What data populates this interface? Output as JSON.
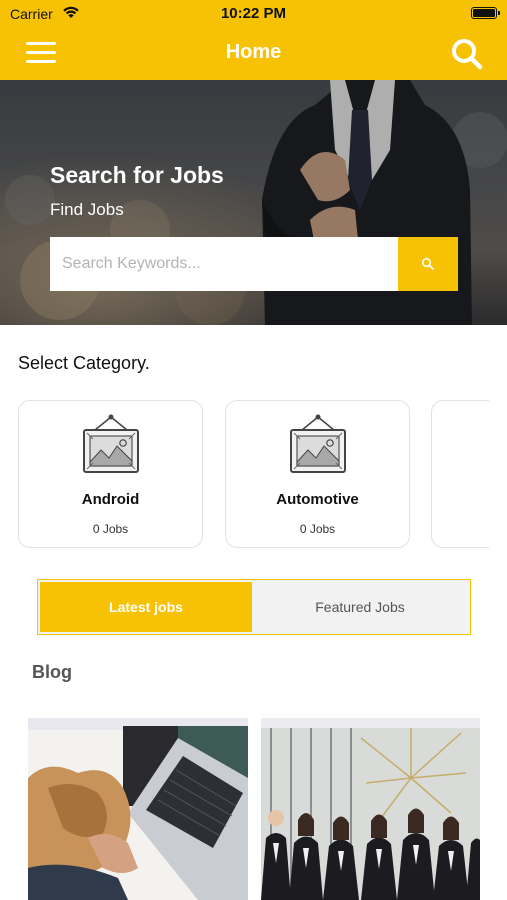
{
  "status_bar": {
    "carrier": "Carrier",
    "time": "10:22 PM"
  },
  "nav": {
    "title": "Home",
    "menu_icon": "hamburger-menu-icon",
    "search_icon": "search-icon"
  },
  "hero": {
    "title": "Search for Jobs",
    "subtitle": "Find Jobs",
    "search": {
      "placeholder": "Search Keywords...",
      "value": "",
      "button_icon": "search-icon"
    }
  },
  "categories": {
    "heading": "Select Category.",
    "items": [
      {
        "name": "Android",
        "count": "0 Jobs",
        "icon": "picture-frame-icon"
      },
      {
        "name": "Automotive",
        "count": "0 Jobs",
        "icon": "picture-frame-icon"
      }
    ]
  },
  "tabs": {
    "latest": "Latest jobs",
    "featured": "Featured Jobs",
    "selected": "latest"
  },
  "blog": {
    "heading": "Blog"
  },
  "colors": {
    "accent": "#f7c204",
    "white": "#ffffff",
    "tab_inactive_bg": "#f2f2f2"
  }
}
